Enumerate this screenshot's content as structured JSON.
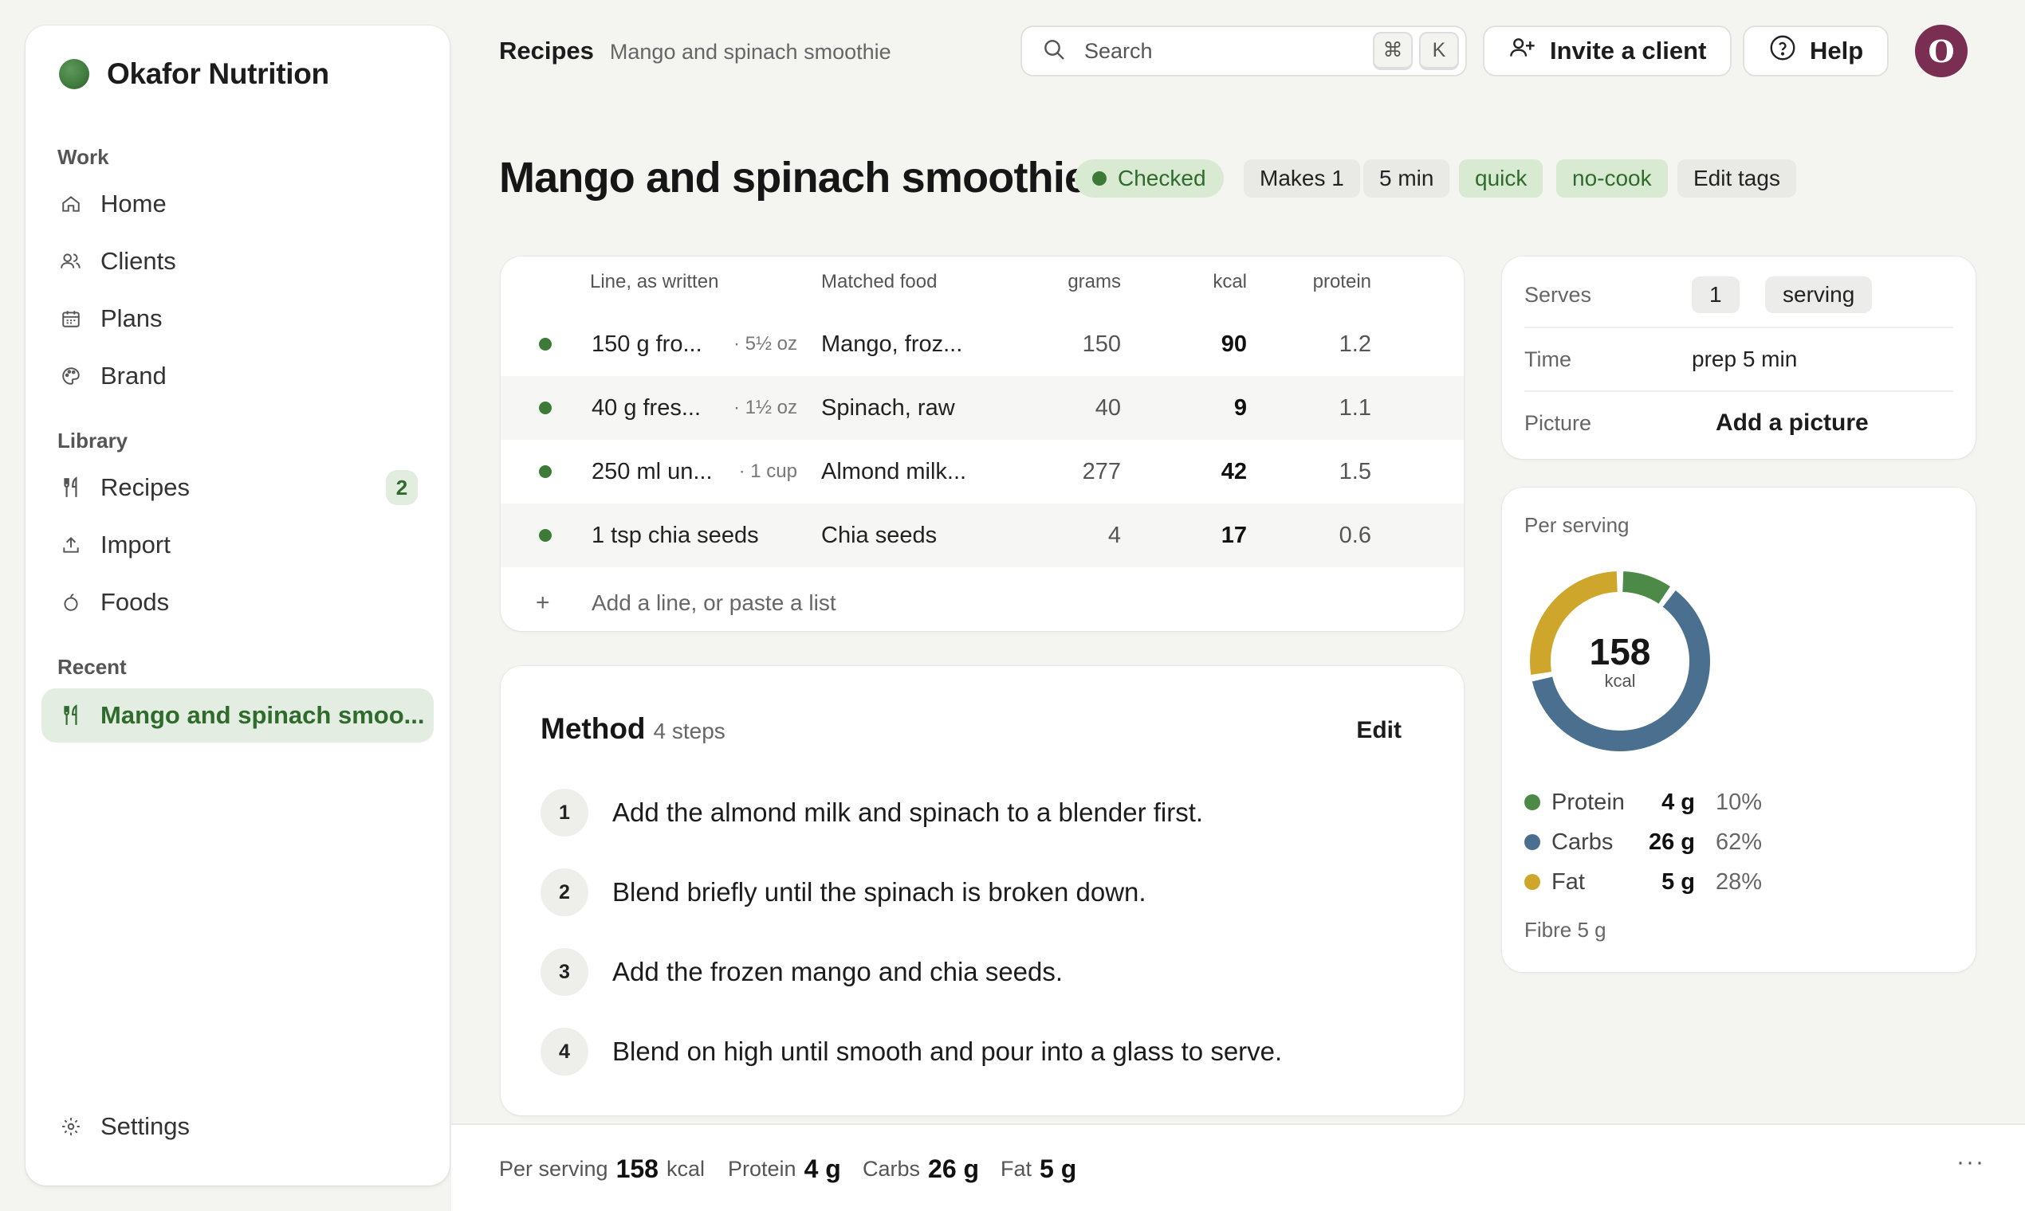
{
  "app": {
    "name": "Okafor Nutrition"
  },
  "sidebar": {
    "sections": {
      "work": "Work",
      "library": "Library",
      "recent": "Recent"
    },
    "items": {
      "home": "Home",
      "clients": "Clients",
      "plans": "Plans",
      "brand": "Brand",
      "recipes": "Recipes",
      "recipes_badge": "2",
      "import": "Import",
      "foods": "Foods",
      "recent_recipe": "Mango and spinach smoo...",
      "settings": "Settings"
    }
  },
  "topbar": {
    "breadcrumb": {
      "section": "Recipes",
      "page": "Mango and spinach smoothie"
    },
    "search": {
      "placeholder": "Search",
      "shortcut_mod": "⌘",
      "shortcut_key": "K"
    },
    "invite_label": "Invite a client",
    "help_label": "Help",
    "avatar_initial": "O"
  },
  "recipe": {
    "title": "Mango and spinach smoothie",
    "status": "Checked",
    "tags": [
      "Makes 1",
      "5 min",
      "quick",
      "no-cook"
    ],
    "edit_tags": "Edit tags"
  },
  "ingredients": {
    "headers": {
      "line": "Line, as written",
      "food": "Matched food",
      "grams": "grams",
      "kcal": "kcal",
      "protein": "protein"
    },
    "rows": [
      {
        "line": "150 g fro...",
        "conv": "· 5½ oz",
        "food": "Mango, froz...",
        "grams": "150",
        "kcal": "90",
        "protein": "1.2"
      },
      {
        "line": "40 g fres...",
        "conv": "· 1½ oz",
        "food": "Spinach, raw",
        "grams": "40",
        "kcal": "9",
        "protein": "1.1"
      },
      {
        "line": "250 ml un...",
        "conv": "· 1 cup",
        "food": "Almond milk...",
        "grams": "277",
        "kcal": "42",
        "protein": "1.5"
      },
      {
        "line": "1 tsp chia seeds",
        "conv": "",
        "food": "Chia seeds",
        "grams": "4",
        "kcal": "17",
        "protein": "0.6"
      }
    ],
    "add_line": "Add a line, or paste a list",
    "add_icon": "+"
  },
  "method": {
    "title": "Method",
    "count": "4 steps",
    "edit": "Edit",
    "steps": [
      {
        "n": "1",
        "text": "Add the almond milk and spinach to a blender first."
      },
      {
        "n": "2",
        "text": "Blend briefly until the spinach is broken down."
      },
      {
        "n": "3",
        "text": "Add the frozen mango and chia seeds."
      },
      {
        "n": "4",
        "text": "Blend on high until smooth and pour into a glass to serve."
      }
    ]
  },
  "info": {
    "serves_label": "Serves",
    "serves_value": "1",
    "serves_unit": "serving",
    "time_label": "Time",
    "time_value": "prep 5 min",
    "picture_label": "Picture",
    "picture_action": "Add a picture"
  },
  "per_serving": {
    "label": "Per serving",
    "kcal": "158",
    "kcal_unit": "kcal",
    "macros": [
      {
        "name": "Protein",
        "grams": "4 g",
        "pct": "10%",
        "fraction": 0.1,
        "color": "#4e8a47"
      },
      {
        "name": "Carbs",
        "grams": "26 g",
        "pct": "62%",
        "fraction": 0.62,
        "color": "#4a6f8f"
      },
      {
        "name": "Fat",
        "grams": "5 g",
        "pct": "28%",
        "fraction": 0.28,
        "color": "#cfa62c"
      }
    ],
    "fibre": "Fibre 5 g"
  },
  "footer": {
    "per_serving_label": "Per serving",
    "kcal_value": "158",
    "kcal_unit": "kcal",
    "protein_label": "Protein",
    "protein_value": "4 g",
    "carbs_label": "Carbs",
    "carbs_value": "26 g",
    "fat_label": "Fat",
    "fat_value": "5 g",
    "more": "···"
  },
  "colors": {
    "accent": "#3c7a38",
    "accent_bg": "#d9ead3",
    "avatar": "#7a2e52"
  }
}
